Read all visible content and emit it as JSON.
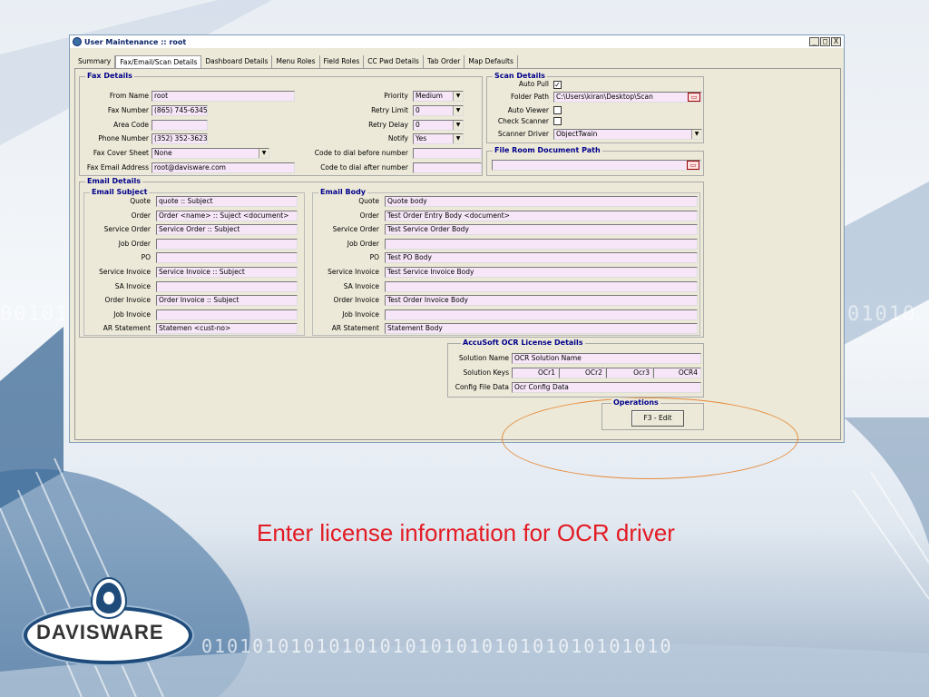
{
  "window": {
    "title": "User Maintenance :: root",
    "controls": [
      "_",
      "□",
      "X"
    ]
  },
  "tabs": [
    "Summary",
    "Fax/Email/Scan Details",
    "Dashboard Details",
    "Menu Roles",
    "Field Roles",
    "CC Pwd Details",
    "Tab Order",
    "Map Defaults"
  ],
  "fax": {
    "legend": "Fax Details",
    "from_name_label": "From Name",
    "from_name": "root",
    "fax_number_label": "Fax Number",
    "fax_number": "(865) 745-6345",
    "area_code_label": "Area Code",
    "area_code": "",
    "phone_label": "Phone Number",
    "phone": "(352) 352-3623",
    "cover_label": "Fax Cover Sheet",
    "cover": "None",
    "email_label": "Fax Email Address",
    "email": "root@davisware.com",
    "priority_label": "Priority",
    "priority": "Medium",
    "retry_limit_label": "Retry Limit",
    "retry_limit": "0",
    "retry_delay_label": "Retry Delay",
    "retry_delay": "0",
    "notify_label": "Notify",
    "notify": "Yes",
    "before_label": "Code to dial before number",
    "before": "",
    "after_label": "Code to dial after number",
    "after": ""
  },
  "scan": {
    "legend": "Scan Details",
    "auto_pull_label": "Auto Pull",
    "auto_pull": "✓",
    "folder_label": "Folder Path",
    "folder": "C:\\Users\\kiran\\Desktop\\Scan",
    "auto_viewer_label": "Auto Viewer",
    "check_scanner_label": "Check Scanner",
    "driver_label": "Scanner Driver",
    "driver": "ObjectTwain"
  },
  "file_room": {
    "legend": "File Room Document Path",
    "path": ""
  },
  "email": {
    "legend": "Email Details",
    "subject_legend": "Email Subject",
    "body_legend": "Email Body",
    "rows": [
      {
        "label": "Quote",
        "subject": "quote :: Subject",
        "body": "Quote body"
      },
      {
        "label": "Order",
        "subject": "Order <name> :: Suject <document>",
        "body": "Test Order Entry Body <document>"
      },
      {
        "label": "Service Order",
        "subject": "Service Order :: Subject",
        "body": "Test Service Order Body"
      },
      {
        "label": "Job Order",
        "subject": "",
        "body": ""
      },
      {
        "label": "PO",
        "subject": "",
        "body": "Test PO Body"
      },
      {
        "label": "Service Invoice",
        "subject": "Service Invoice :: Subject",
        "body": "Test Service Invoice Body"
      },
      {
        "label": "SA Invoice",
        "subject": "",
        "body": ""
      },
      {
        "label": "Order Invoice",
        "subject": "Order Invoice :: Subject",
        "body": "Test Order Invoice Body"
      },
      {
        "label": "Job Invoice",
        "subject": "",
        "body": ""
      },
      {
        "label": "AR Statement",
        "subject": "Statemen <cust-no>",
        "body": "Statement Body"
      }
    ]
  },
  "ocr": {
    "legend": "AccuSoft OCR License Details",
    "solution_name_label": "Solution Name",
    "solution_name": "OCR Solution Name",
    "solution_keys_label": "Solution Keys",
    "keys": [
      "OCr1",
      "OCr2",
      "Ocr3",
      "OCR4"
    ],
    "config_label": "Config File Data",
    "config": "Ocr Config Data"
  },
  "operations": {
    "legend": "Operations",
    "edit_label": "F3 - Edit"
  },
  "caption": "Enter license information for OCR driver",
  "logo": {
    "text": "DAVISWARE"
  },
  "background": {
    "binary_left": "00101",
    "binary_right": "01010",
    "binary_bottom": "0101010101010101010101010101010101010"
  }
}
